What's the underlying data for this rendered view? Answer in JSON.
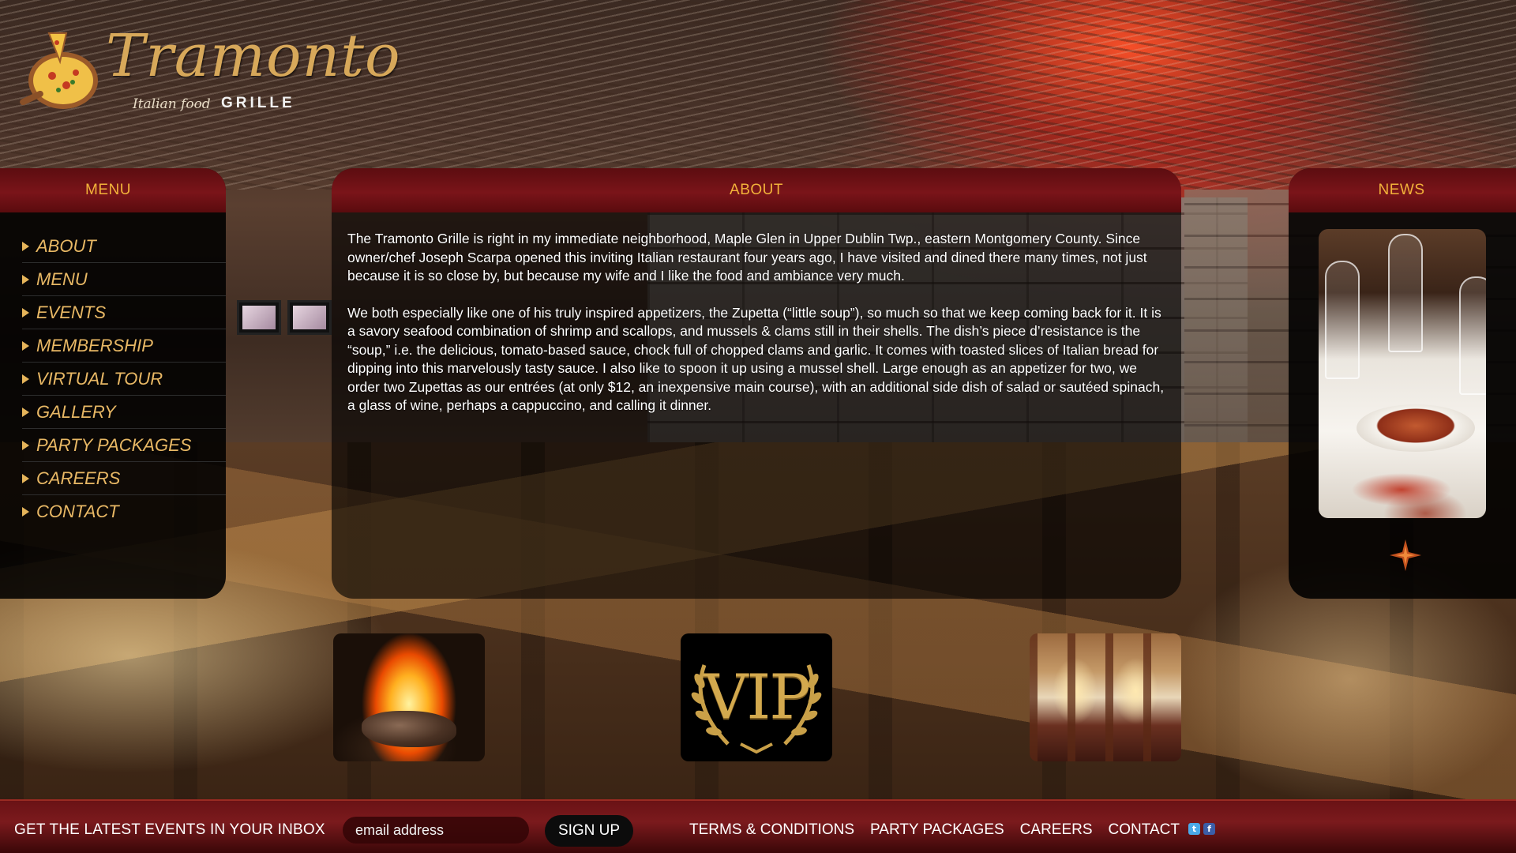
{
  "logo": {
    "brand": "Tramonto",
    "tagline": "Italian food",
    "suffix": "GRILLE"
  },
  "menu_panel": {
    "title": "MENU",
    "items": [
      {
        "label": "ABOUT"
      },
      {
        "label": "MENU"
      },
      {
        "label": "EVENTS"
      },
      {
        "label": "MEMBERSHIP"
      },
      {
        "label": "VIRTUAL TOUR"
      },
      {
        "label": "GALLERY"
      },
      {
        "label": "PARTY PACKAGES"
      },
      {
        "label": "CAREERS"
      },
      {
        "label": "CONTACT"
      }
    ]
  },
  "about_panel": {
    "title": "ABOUT",
    "paragraphs": [
      "The Tramonto Grille is right in my immediate neighborhood, Maple Glen in Upper Dublin Twp., eastern Montgomery County. Since owner/chef Joseph Scarpa opened this inviting Italian restaurant four years ago, I have visited and dined there many times, not just because it is so close by, but because my wife and I like the food and ambiance very much.",
      "We both especially like one of his truly inspired appetizers, the Zupetta (“little soup”), so much so that we keep coming back for it. It is a savory seafood combination of shrimp and scallops, and mussels & clams still in their shells. The dish’s piece d’resistance is the “soup,” i.e. the delicious, tomato-based sauce, chock full of chopped clams and garlic. It comes with toasted slices of Italian bread for dipping into this marvelously tasty sauce. I also like to spoon it up using a mussel shell. Large enough as an appetizer for two, we order two Zupettas as our entrées (at only $12, an inexpensive main course), with an additional side dish of salad or sautéed spinach, a glass of wine, perhaps a cappuccino, and calling it dinner."
    ]
  },
  "news_panel": {
    "title": "NEWS"
  },
  "thumbnails": {
    "vip_text": "VIP"
  },
  "footer": {
    "cta": "GET THE LATEST EVENTS IN YOUR INBOX",
    "email_placeholder": "email address",
    "signup_label": "SIGN UP",
    "links": [
      {
        "label": "TERMS & CONDITIONS"
      },
      {
        "label": "PARTY PACKAGES"
      },
      {
        "label": "CAREERS"
      },
      {
        "label": "CONTACT"
      }
    ],
    "social": [
      {
        "icon": "twitter-icon",
        "glyph": "t"
      },
      {
        "icon": "facebook-icon",
        "glyph": "f"
      }
    ]
  },
  "colors": {
    "accent_gold": "#e8b865",
    "panel_header_red": "#7a1419",
    "footer_red": "#7b1a1d",
    "header_text": "#f2b23a"
  }
}
